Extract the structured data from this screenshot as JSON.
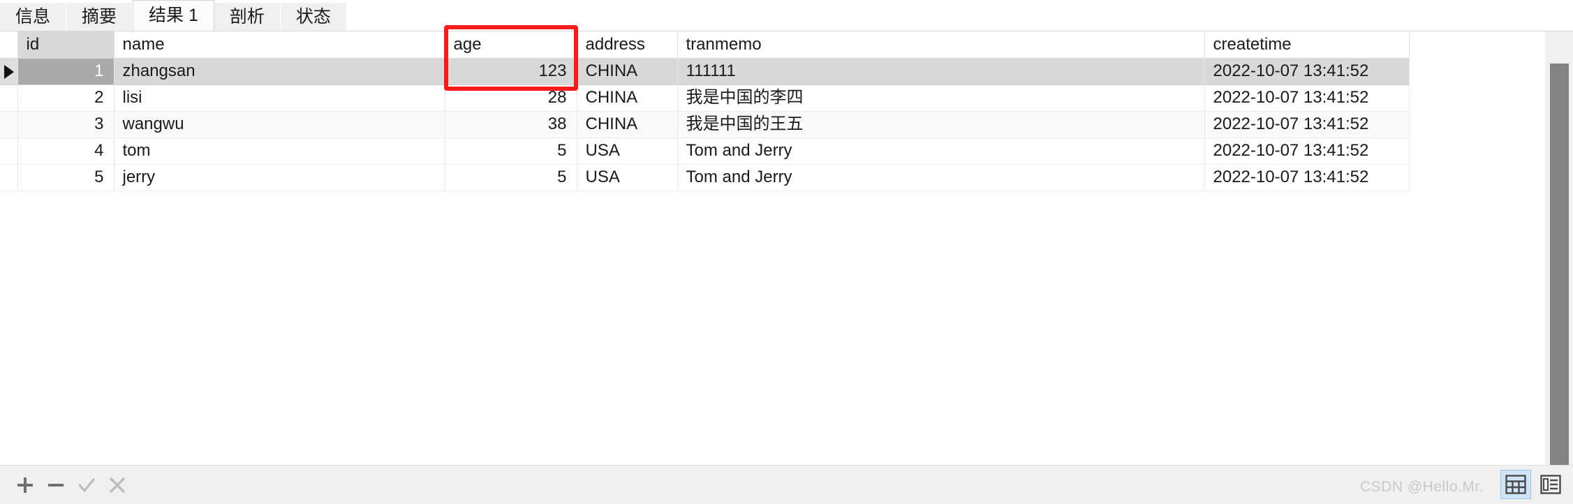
{
  "tabs": [
    {
      "label": "信息",
      "active": false
    },
    {
      "label": "摘要",
      "active": false
    },
    {
      "label": "结果 1",
      "active": true
    },
    {
      "label": "剖析",
      "active": false
    },
    {
      "label": "状态",
      "active": false
    }
  ],
  "grid": {
    "columns": [
      {
        "key": "id",
        "label": "id",
        "align": "right",
        "selected": true
      },
      {
        "key": "name",
        "label": "name",
        "align": "left",
        "selected": false
      },
      {
        "key": "age",
        "label": "age",
        "align": "right",
        "selected": false
      },
      {
        "key": "address",
        "label": "address",
        "align": "left",
        "selected": false
      },
      {
        "key": "tranmemo",
        "label": "tranmemo",
        "align": "left",
        "selected": false
      },
      {
        "key": "createtime",
        "label": "createtime",
        "align": "left",
        "selected": false
      }
    ],
    "rows": [
      {
        "id": "1",
        "name": "zhangsan",
        "age": "123",
        "address": "CHINA",
        "tranmemo": "111111",
        "createtime": "2022-10-07 13:41:52",
        "selected": true
      },
      {
        "id": "2",
        "name": "lisi",
        "age": "28",
        "address": "CHINA",
        "tranmemo": "我是中国的李四",
        "createtime": "2022-10-07 13:41:52",
        "selected": false
      },
      {
        "id": "3",
        "name": "wangwu",
        "age": "38",
        "address": "CHINA",
        "tranmemo": "我是中国的王五",
        "createtime": "2022-10-07 13:41:52",
        "selected": false
      },
      {
        "id": "4",
        "name": "tom",
        "age": "5",
        "address": "USA",
        "tranmemo": "Tom and Jerry",
        "createtime": "2022-10-07 13:41:52",
        "selected": false
      },
      {
        "id": "5",
        "name": "jerry",
        "age": "5",
        "address": "USA",
        "tranmemo": "Tom and Jerry",
        "createtime": "2022-10-07 13:41:52",
        "selected": false
      }
    ],
    "row_marker_icon": "play-triangle-icon"
  },
  "annotation": {
    "color": "#f71b1b",
    "target_column": "age",
    "shape": "rectangle"
  },
  "toolbar": {
    "buttons": [
      {
        "name": "add-record-button",
        "icon": "plus-icon",
        "enabled": true
      },
      {
        "name": "delete-record-button",
        "icon": "minus-icon",
        "enabled": true
      },
      {
        "name": "apply-changes-button",
        "icon": "check-icon",
        "enabled": false
      },
      {
        "name": "cancel-changes-button",
        "icon": "cross-icon",
        "enabled": false
      }
    ],
    "view_modes": [
      {
        "name": "grid-view-button",
        "icon": "grid-icon",
        "selected": true
      },
      {
        "name": "form-view-button",
        "icon": "form-icon",
        "selected": false
      }
    ]
  },
  "scrollbar": {
    "orientation": "vertical",
    "thumb_position": "top"
  },
  "watermark": {
    "text": "CSDN @Hello.Mr."
  }
}
